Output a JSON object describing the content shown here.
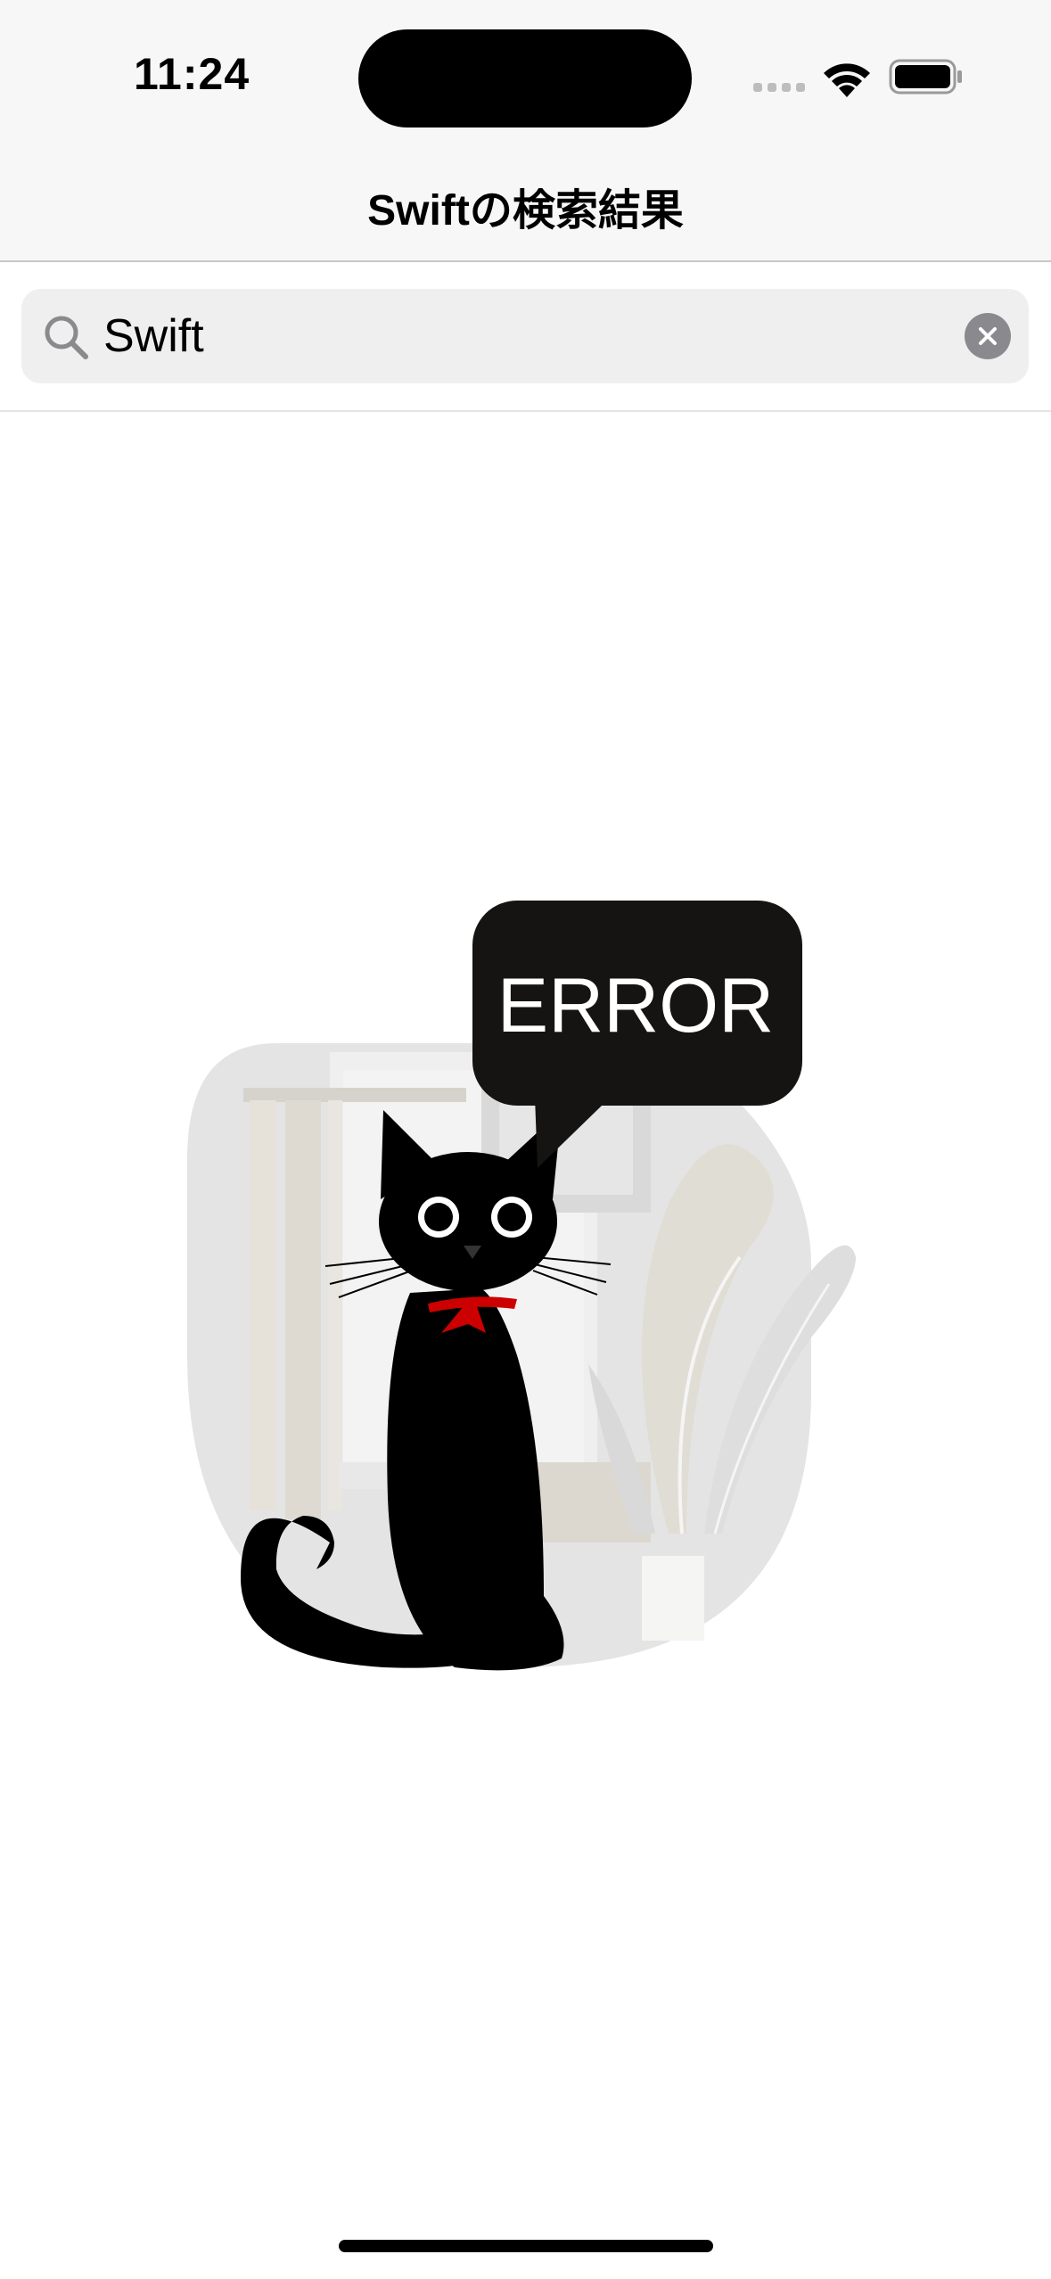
{
  "status_bar": {
    "time": "11:24"
  },
  "navigation": {
    "title": "Swiftの検索結果"
  },
  "search": {
    "value": "Swift",
    "icon": "search-icon",
    "clear_icon": "clear-icon"
  },
  "error_illustration": {
    "bubble_text": "ERROR",
    "icon": "black-cat-error-illustration"
  },
  "colors": {
    "bar_background": "#f7f7f7",
    "search_background": "#efefef",
    "bubble": "#151412",
    "collar": "#cc0000"
  }
}
